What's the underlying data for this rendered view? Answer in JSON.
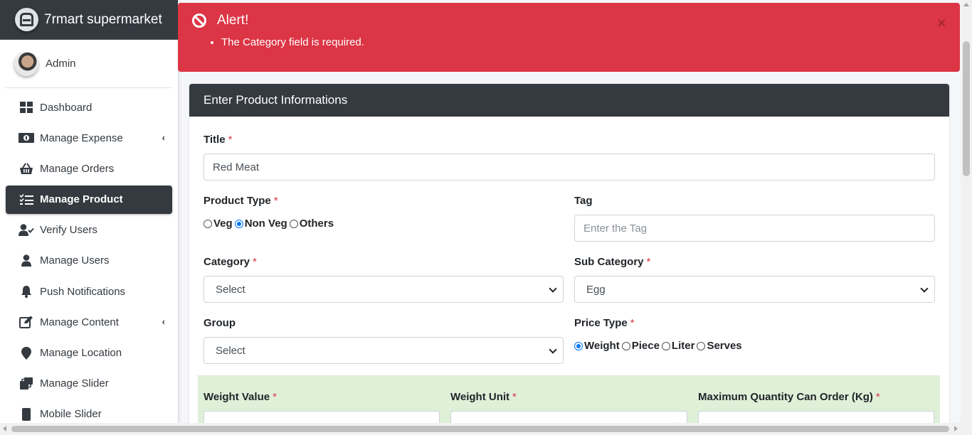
{
  "brand": {
    "name": "7rmart supermarket"
  },
  "user": {
    "name": "Admin"
  },
  "sidebar": {
    "items": [
      {
        "label": "Dashboard",
        "icon": "dashboard-icon"
      },
      {
        "label": "Manage Expense",
        "icon": "money-icon",
        "has_submenu": true
      },
      {
        "label": "Manage Orders",
        "icon": "basket-icon"
      },
      {
        "label": "Manage Product",
        "icon": "tasks-icon",
        "active": true
      },
      {
        "label": "Verify Users",
        "icon": "user-check-icon"
      },
      {
        "label": "Manage Users",
        "icon": "user-icon"
      },
      {
        "label": "Push Notifications",
        "icon": "bell-icon"
      },
      {
        "label": "Manage Content",
        "icon": "edit-icon",
        "has_submenu": true
      },
      {
        "label": "Manage Location",
        "icon": "map-marker-icon"
      },
      {
        "label": "Manage Slider",
        "icon": "slider-icon"
      },
      {
        "label": "Mobile Slider",
        "icon": "mobile-icon"
      }
    ]
  },
  "alert": {
    "title": "Alert!",
    "messages": [
      "The Category field is required."
    ],
    "close": "×",
    "color": "#dc3545"
  },
  "form": {
    "header": "Enter Product Informations",
    "title": {
      "label": "Title",
      "value": "Red Meat"
    },
    "product_type": {
      "label": "Product Type",
      "options": [
        "Veg",
        "Non Veg",
        "Others"
      ],
      "selected": "Non Veg"
    },
    "tag": {
      "label": "Tag",
      "placeholder": "Enter the Tag"
    },
    "category": {
      "label": "Category",
      "value": "Select"
    },
    "sub_category": {
      "label": "Sub Category",
      "value": "Egg"
    },
    "group": {
      "label": "Group",
      "value": "Select"
    },
    "price_type": {
      "label": "Price Type",
      "options": [
        "Weight",
        "Piece",
        "Liter",
        "Serves"
      ],
      "selected": "Weight"
    },
    "weight_value": {
      "label": "Weight Value"
    },
    "weight_unit": {
      "label": "Weight Unit"
    },
    "max_quantity": {
      "label": "Maximum Quantity Can Order (Kg)"
    }
  },
  "colors": {
    "dark": "#343a40",
    "danger": "#dc3545",
    "accent": "#0075ff",
    "band": "#dff0d8"
  }
}
